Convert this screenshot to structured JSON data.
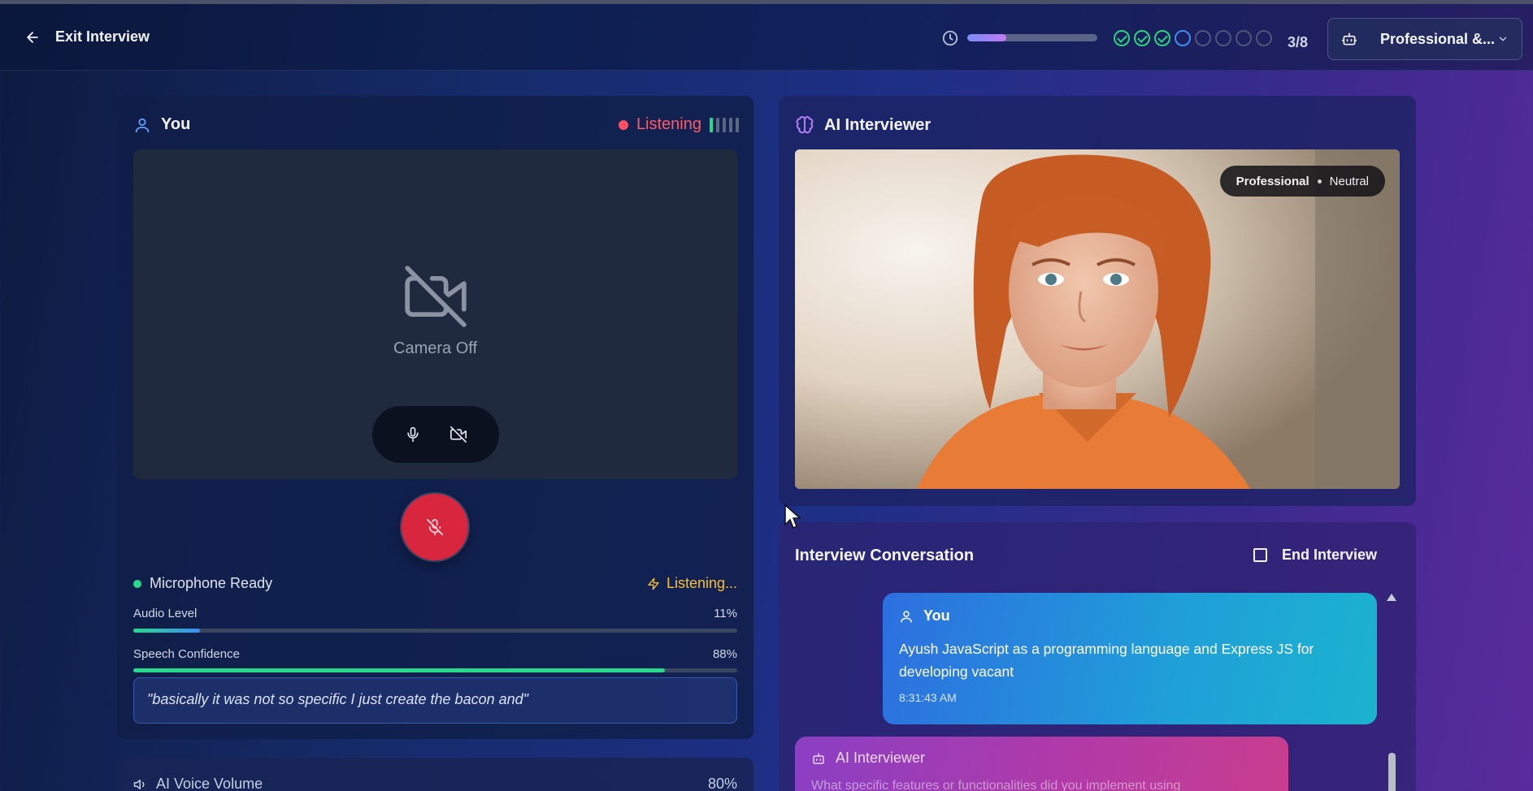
{
  "header": {
    "exit_label": "Exit Interview",
    "progress_fraction": 0.3,
    "steps": [
      "done",
      "done",
      "done",
      "current",
      "pending",
      "pending",
      "pending",
      "pending"
    ],
    "counter": "3/8",
    "persona_label": "Professional &..."
  },
  "you_panel": {
    "title": "You",
    "status": "Listening",
    "camera_off_label": "Camera Off",
    "mic_status": "Microphone Ready",
    "listening_status": "Listening...",
    "audio_level_label": "Audio Level",
    "audio_level_value": "11%",
    "audio_level_fraction": 0.11,
    "speech_confidence_label": "Speech Confidence",
    "speech_confidence_value": "88%",
    "speech_confidence_fraction": 0.88,
    "transcript": "\"basically it was not so specific I just create the bacon and\""
  },
  "ai_panel": {
    "title": "AI Interviewer",
    "tone_style": "Professional",
    "tone_mood": "Neutral"
  },
  "conversation": {
    "title": "Interview Conversation",
    "end_label": "End Interview",
    "messages": [
      {
        "sender": "You",
        "text": "Ayush JavaScript as a programming language and Express JS for developing vacant",
        "time": "8:31:43 AM"
      },
      {
        "sender": "AI Interviewer",
        "text": "What specific features or functionalities did you implement using"
      }
    ]
  },
  "volume": {
    "label": "AI Voice Volume",
    "value": "80%"
  },
  "colors": {
    "accent_green": "#27d98c",
    "accent_red": "#d7263d",
    "accent_yellow": "#f7c12a",
    "accent_blue": "#3f8cf0"
  },
  "icons": [
    "arrow-left-icon",
    "clock-icon",
    "bot-icon",
    "chevron-down-icon",
    "user-icon",
    "camera-off-icon",
    "mic-icon",
    "mic-off-icon",
    "zap-icon",
    "brain-icon",
    "speaker-icon"
  ]
}
